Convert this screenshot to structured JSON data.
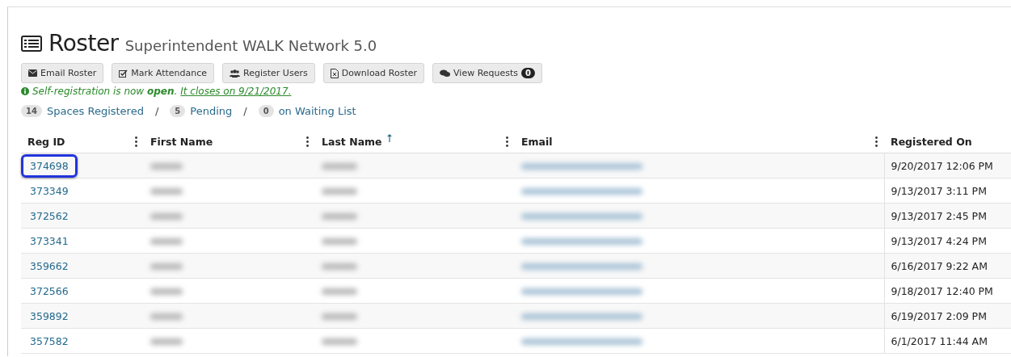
{
  "header": {
    "title": "Roster",
    "subtitle": "Superintendent WALK Network 5.0"
  },
  "toolbar": [
    {
      "kind": "email",
      "label": "Email Roster"
    },
    {
      "kind": "check",
      "label": "Mark Attendance"
    },
    {
      "kind": "users",
      "label": "Register Users"
    },
    {
      "kind": "download",
      "label": "Download Roster"
    },
    {
      "kind": "requests",
      "label": "View Requests",
      "badge": "0"
    }
  ],
  "notice": {
    "text": "Self-registration is now **open**.",
    "link": "It closes on 9/21/2017."
  },
  "counts": [
    {
      "count": "14",
      "label": "Spaces Registered"
    },
    {
      "separator": "/",
      "count": "5",
      "label": "Pending"
    },
    {
      "separator": "/",
      "count": "0",
      "label": "on Waiting List"
    }
  ],
  "table": {
    "columns": [
      {
        "label": "Reg ID",
        "menu": true,
        "sorted": false
      },
      {
        "label": "First Name",
        "menu": true,
        "sorted": false
      },
      {
        "label": "Last Name",
        "menu": true,
        "sorted": true
      },
      {
        "label": "Email",
        "menu": true,
        "sorted": false
      },
      {
        "label": "Registered On",
        "menu": false,
        "sorted": false
      }
    ],
    "rows": [
      {
        "reg_id": "374698",
        "registered_on": "9/20/2017 12:06 PM",
        "highlighted": true
      },
      {
        "reg_id": "373349",
        "registered_on": "9/13/2017 3:11 PM",
        "highlighted": false
      },
      {
        "reg_id": "372562",
        "registered_on": "9/13/2017 2:45 PM",
        "highlighted": false
      },
      {
        "reg_id": "373341",
        "registered_on": "9/13/2017 4:24 PM",
        "highlighted": false
      },
      {
        "reg_id": "359662",
        "registered_on": "6/16/2017 9:22 AM",
        "highlighted": false
      },
      {
        "reg_id": "372566",
        "registered_on": "9/18/2017 12:40 PM",
        "highlighted": false
      },
      {
        "reg_id": "359892",
        "registered_on": "6/19/2017 2:09 PM",
        "highlighted": false
      },
      {
        "reg_id": "357582",
        "registered_on": "6/1/2017 11:44 AM",
        "highlighted": false
      }
    ]
  }
}
